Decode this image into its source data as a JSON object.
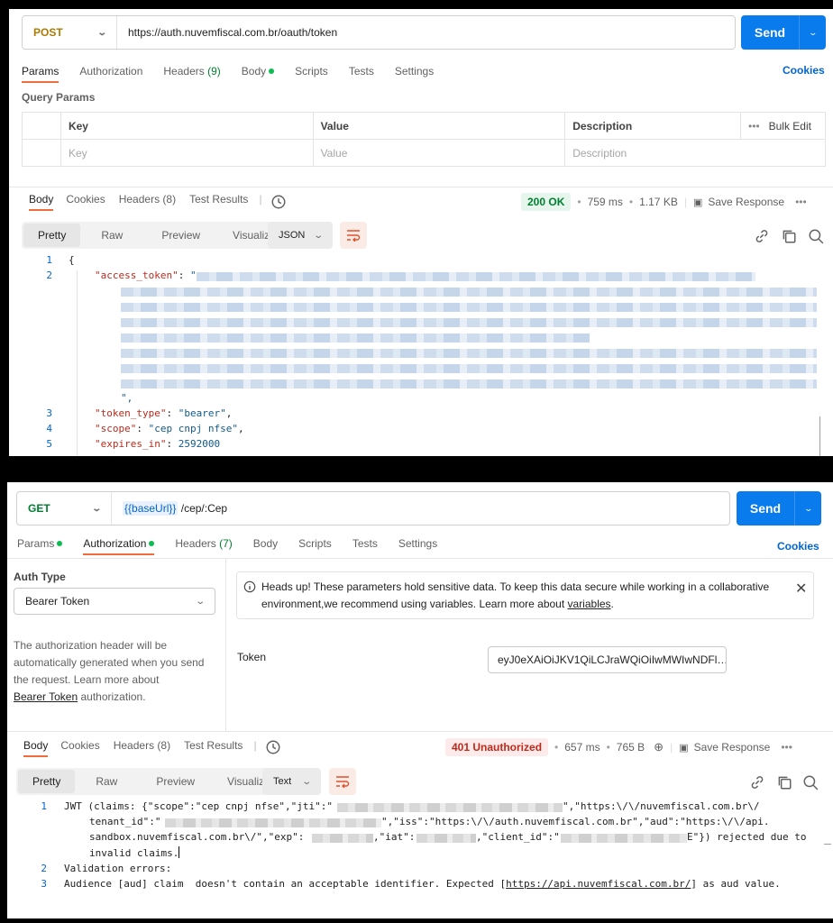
{
  "top": {
    "request": {
      "method": "POST",
      "url": "https://auth.nuvemfiscal.com.br/oauth/token",
      "send": "Send"
    },
    "tabs": [
      {
        "label": "Params",
        "active": true
      },
      {
        "label": "Authorization"
      },
      {
        "label": "Headers",
        "count": "(9)"
      },
      {
        "label": "Body",
        "dot": true
      },
      {
        "label": "Scripts"
      },
      {
        "label": "Tests"
      },
      {
        "label": "Settings"
      }
    ],
    "cookies": "Cookies",
    "query_params_title": "Query Params",
    "table": {
      "headers": {
        "key": "Key",
        "value": "Value",
        "description": "Description",
        "bulk": "Bulk Edit"
      },
      "placeholders": {
        "key": "Key",
        "value": "Value",
        "description": "Description"
      }
    },
    "response_tabs": [
      "Body",
      "Cookies",
      "Headers (8)",
      "Test Results"
    ],
    "status": "200 OK",
    "time": "759 ms",
    "size": "1.17 KB",
    "save_response": "Save Response",
    "view_modes": [
      "Pretty",
      "Raw",
      "Preview",
      "Visualize"
    ],
    "format": "JSON",
    "code": {
      "l1": "{",
      "k_access": "\"access_token\"",
      "close_str": "\",",
      "k_type": "\"token_type\"",
      "v_type": "\"bearer\"",
      "k_scope": "\"scope\"",
      "v_scope": "\"cep cnpj nfse\"",
      "k_exp": "\"expires_in\"",
      "v_exp": "2592000"
    }
  },
  "bottom": {
    "request": {
      "method": "GET",
      "url_var": "{{baseUrl}}",
      "url_path": "/cep/:Cep",
      "send": "Send"
    },
    "tabs": [
      {
        "label": "Params",
        "dot": true
      },
      {
        "label": "Authorization",
        "dot": true,
        "active": true
      },
      {
        "label": "Headers",
        "count": "(7)"
      },
      {
        "label": "Body"
      },
      {
        "label": "Scripts"
      },
      {
        "label": "Tests"
      },
      {
        "label": "Settings"
      }
    ],
    "cookies": "Cookies",
    "auth_type_label": "Auth Type",
    "auth_type_value": "Bearer Token",
    "auth_help_1": "The authorization header will be",
    "auth_help_2": "automatically generated when you send",
    "auth_help_3": "the request. Learn more about",
    "auth_help_link": "Bearer Token",
    "auth_help_4": " authorization.",
    "notice_line1": "Heads up! These parameters hold sensitive data. To keep this data secure while working in a collaborative",
    "notice_line2": "environment,we recommend using variables. Learn more about ",
    "notice_link": "variables",
    "notice_end": ".",
    "token_label": "Token",
    "token_value": "eyJ0eXAiOiJKV1QiLCJraWQiOiIwMWIwNDFl…",
    "response_tabs": [
      "Body",
      "Cookies",
      "Headers (8)",
      "Test Results"
    ],
    "status": "401 Unauthorized",
    "time": "657 ms",
    "size": "765 B",
    "save_response": "Save Response",
    "view_modes": [
      "Pretty",
      "Raw",
      "Preview",
      "Visualize"
    ],
    "format": "Text",
    "lines": {
      "l1a": "JWT (claims: {\"scope\":\"cep cnpj nfse\",\"jti\":\"",
      "l1b": "\",\"https:\\/\\/nuvemfiscal.com.br\\/",
      "l1c": "tenant_id\":\"",
      "l1d": "\",\"iss\":\"https:\\/\\/auth.nuvemfiscal.com.br\",\"aud\":\"https:\\/\\/api.",
      "l1e": "sandbox.nuvemfiscal.com.br\\/\",\"exp\":",
      "l1f": ",\"iat\":",
      "l1g": ",\"client_id\":\"",
      "l1h": "E\"}) rejected due to",
      "l1i": "invalid claims.",
      "l2": "Validation errors:",
      "l3a": "Audience [aud] claim  doesn't contain an acceptable identifier. Expected [",
      "l3link": "https://api.nuvemfiscal.com.br/",
      "l3b": "] as aud value."
    }
  }
}
